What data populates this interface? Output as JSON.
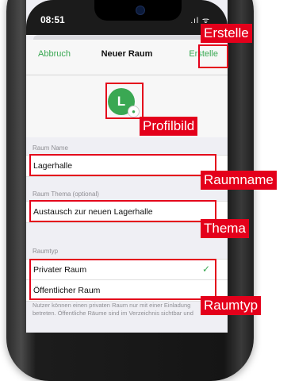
{
  "status_bar": {
    "time": "08:51",
    "icons": ".ıl ᯤ"
  },
  "navbar": {
    "cancel": "Abbruch",
    "title": "Neuer Raum",
    "create": "Erstelle"
  },
  "avatar": {
    "initial": "L"
  },
  "room_name": {
    "label": "Raum Name",
    "value": "Lagerhalle"
  },
  "room_topic": {
    "label": "Raum Thema (optional)",
    "value": "Austausch zur neuen Lagerhalle"
  },
  "room_type": {
    "label": "Raumtyp",
    "options": [
      {
        "label": "Privater Raum",
        "selected": true
      },
      {
        "label": "Öffentlicher Raum",
        "selected": false
      }
    ],
    "footnote": "Nutzer können einen privaten Raum nur mit einer Einladung betreten. Öffentliche Räume sind im Verzeichnis sichtbar und"
  },
  "annotations": {
    "create": "Erstelle",
    "profile_pic": "Profilbild",
    "room_name": "Raumname",
    "topic": "Thema",
    "room_type": "Raumtyp"
  },
  "colors": {
    "accent": "#3aa853",
    "highlight": "#e4001b"
  }
}
